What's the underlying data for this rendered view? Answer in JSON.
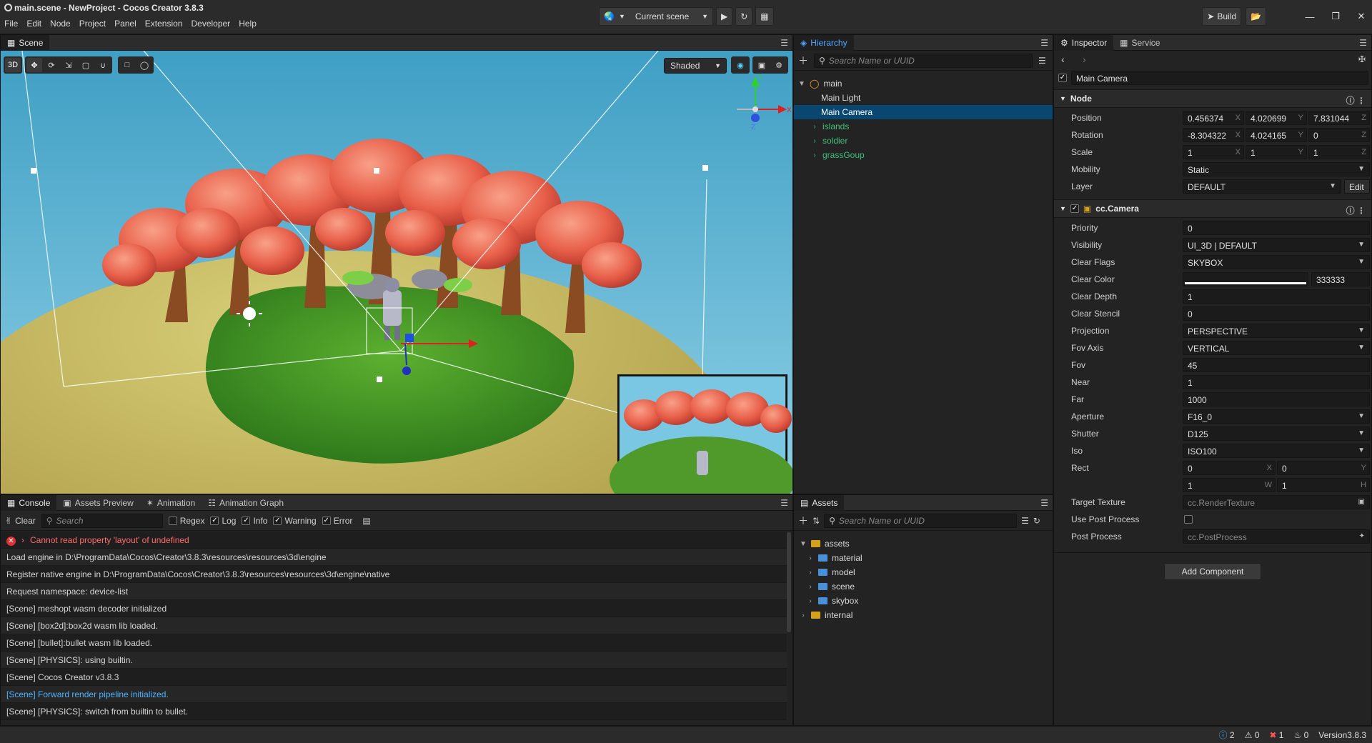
{
  "window": {
    "title": "main.scene - NewProject - Cocos Creator 3.8.3"
  },
  "menu": [
    "File",
    "Edit",
    "Node",
    "Project",
    "Panel",
    "Extension",
    "Developer",
    "Help"
  ],
  "toolbar": {
    "scene_select": "Current scene",
    "build": "Build"
  },
  "scene_panel": {
    "tab": "Scene",
    "mode_3d": "3D",
    "shading": "Shaded",
    "gizmo": {
      "x": "X",
      "y": "Y",
      "z": "Z"
    }
  },
  "console_panel": {
    "tabs": [
      "Console",
      "Assets Preview",
      "Animation",
      "Animation Graph"
    ],
    "clear": "Clear",
    "search_placeholder": "Search",
    "filters": {
      "regex": "Regex",
      "log": "Log",
      "info": "Info",
      "warning": "Warning",
      "error": "Error"
    },
    "logs": [
      {
        "text": "Cannot read property 'layout' of undefined",
        "level": "error"
      },
      {
        "text": "Load engine in D:\\ProgramData\\Cocos\\Creator\\3.8.3\\resources\\resources\\3d\\engine",
        "level": "log"
      },
      {
        "text": "Register native engine in D:\\ProgramData\\Cocos\\Creator\\3.8.3\\resources\\resources\\3d\\engine\\native",
        "level": "log"
      },
      {
        "text": "Request namespace: device-list",
        "level": "log"
      },
      {
        "text": "[Scene] meshopt wasm decoder initialized",
        "level": "log"
      },
      {
        "text": "[Scene] [box2d]:box2d wasm lib loaded.",
        "level": "log"
      },
      {
        "text": "[Scene] [bullet]:bullet wasm lib loaded.",
        "level": "log"
      },
      {
        "text": "[Scene] [PHYSICS]: using builtin.",
        "level": "log"
      },
      {
        "text": "[Scene] Cocos Creator v3.8.3",
        "level": "log"
      },
      {
        "text": "[Scene] Forward render pipeline initialized.",
        "level": "info"
      },
      {
        "text": "[Scene] [PHYSICS]: switch from builtin to bullet.",
        "level": "log"
      }
    ]
  },
  "hierarchy_panel": {
    "tab": "Hierarchy",
    "search_placeholder": "Search Name or UUID",
    "root": "main",
    "nodes": [
      {
        "label": "Main Light",
        "type": "child"
      },
      {
        "label": "Main Camera",
        "type": "selected"
      },
      {
        "label": "islands",
        "type": "prefab"
      },
      {
        "label": "soldier",
        "type": "prefab"
      },
      {
        "label": "grassGoup",
        "type": "prefab"
      }
    ]
  },
  "assets_panel": {
    "tab": "Assets",
    "search_placeholder": "Search Name or UUID",
    "root": "assets",
    "folders": [
      "material",
      "model",
      "scene",
      "skybox"
    ],
    "internal": "internal"
  },
  "inspector_panel": {
    "tabs": [
      "Inspector",
      "Service"
    ],
    "node_name": "Main Camera",
    "node_section": "Node",
    "position": [
      "0.456374",
      "4.020699",
      "7.831044"
    ],
    "rotation": [
      "-8.304322",
      "4.024165",
      "0"
    ],
    "scale": [
      "1",
      "1",
      "1"
    ],
    "axis": {
      "x": "X",
      "y": "Y",
      "z": "Z",
      "w": "W",
      "h": "H"
    },
    "labels": {
      "position": "Position",
      "rotation": "Rotation",
      "scale": "Scale",
      "mobility": "Mobility",
      "layer": "Layer",
      "priority": "Priority",
      "visibility": "Visibility",
      "clear_flags": "Clear Flags",
      "clear_color": "Clear Color",
      "clear_depth": "Clear Depth",
      "clear_stencil": "Clear Stencil",
      "projection": "Projection",
      "fov_axis": "Fov Axis",
      "fov": "Fov",
      "near": "Near",
      "far": "Far",
      "aperture": "Aperture",
      "shutter": "Shutter",
      "iso": "Iso",
      "rect": "Rect",
      "target_texture": "Target Texture",
      "use_post_process": "Use Post Process",
      "post_process": "Post Process"
    },
    "mobility": "Static",
    "layer": "DEFAULT",
    "edit": "Edit",
    "camera_section": "cc.Camera",
    "priority": "0",
    "visibility": "UI_3D | DEFAULT",
    "clear_flags": "SKYBOX",
    "clear_color": "333333",
    "clear_depth": "1",
    "clear_stencil": "0",
    "projection": "PERSPECTIVE",
    "fov_axis": "VERTICAL",
    "fov": "45",
    "near": "1",
    "far": "1000",
    "aperture": "F16_0",
    "shutter": "D125",
    "iso": "ISO100",
    "rect": [
      "0",
      "0",
      "1",
      "1"
    ],
    "target_texture": "cc.RenderTexture",
    "post_process": "cc.PostProcess",
    "add_component": "Add Component"
  },
  "status_bar": {
    "info_count": "2",
    "warn_count": "0",
    "error_count": "1",
    "notify_count": "0",
    "version": "Version3.8.3"
  }
}
